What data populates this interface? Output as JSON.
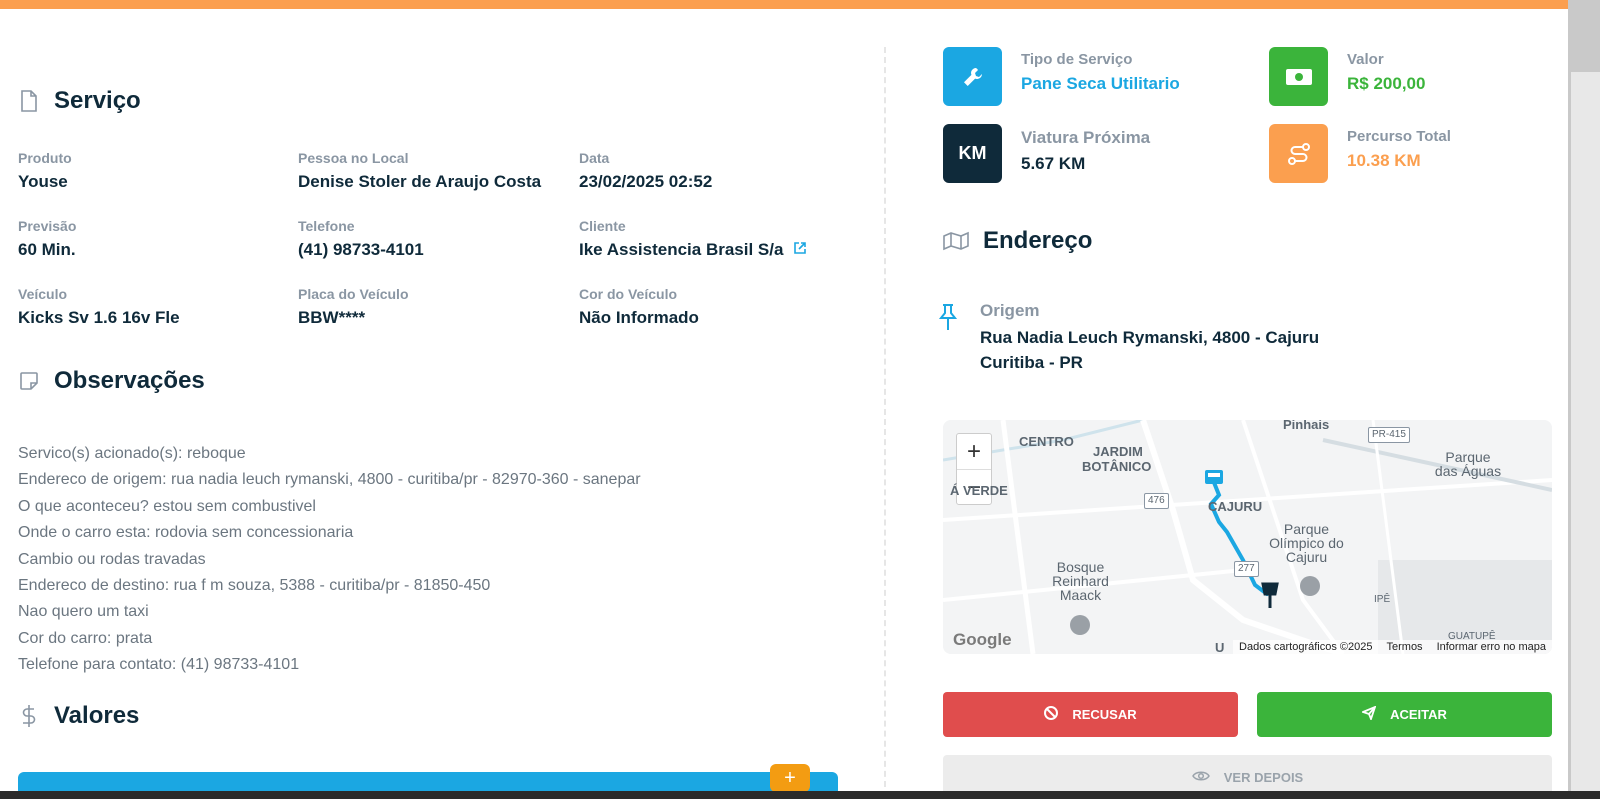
{
  "servico": {
    "title": "Serviço",
    "fields": [
      {
        "label": "Produto",
        "value": "Youse"
      },
      {
        "label": "Pessoa no Local",
        "value": "Denise Stoler de Araujo Costa"
      },
      {
        "label": "Data",
        "value": "23/02/2025 02:52"
      },
      {
        "label": "Previsão",
        "value": "60 Min."
      },
      {
        "label": "Telefone",
        "value": "(41) 98733-4101"
      },
      {
        "label": "Cliente",
        "value": "Ike Assistencia Brasil S/a"
      },
      {
        "label": "Veículo",
        "value": "Kicks Sv 1.6 16v Fle"
      },
      {
        "label": "Placa do Veículo",
        "value": "BBW****"
      },
      {
        "label": "Cor do Veículo",
        "value": "Não Informado"
      }
    ]
  },
  "observacoes": {
    "title": "Observações",
    "lines": [
      "Servico(s) acionado(s): reboque",
      "Endereco de origem: rua nadia leuch rymanski, 4800 - curitiba/pr - 82970-360 - sanepar",
      "O que aconteceu? estou sem combustivel",
      "Onde o carro esta: rodovia sem concessionaria",
      "Cambio ou rodas travadas",
      "Endereco de destino: rua f m souza, 5388 - curitiba/pr - 81850-450",
      "Nao quero um taxi",
      "Cor do carro: prata",
      "Telefone para contato: (41) 98733-4101"
    ]
  },
  "valores": {
    "title": "Valores",
    "add_label": "+"
  },
  "stats": [
    {
      "label": "Tipo de Serviço",
      "value": "Pane Seca Utilitario",
      "icon": "wrench-icon",
      "color": "#1ba7e2"
    },
    {
      "label": "Valor",
      "value": "R$ 200,00",
      "icon": "money-icon",
      "color": "#3bb43b"
    },
    {
      "label": "Viatura Próxima",
      "value": "5.67 KM",
      "icon": "KM",
      "color": "#0f2a3a"
    },
    {
      "label": "Percurso Total",
      "value": "10.38 KM",
      "icon": "route-icon",
      "color": "#fb9f4f"
    }
  ],
  "endereco": {
    "title": "Endereço",
    "origem_label": "Origem",
    "line1": "Rua Nadia Leuch Rymanski, 4800 - Cajuru",
    "line2": "Curitiba - PR"
  },
  "map": {
    "zoom_in": "+",
    "zoom_out": "−",
    "labels": {
      "pinhais": "Pinhais",
      "pr415": "PR-415",
      "centro": "CENTRO",
      "jardim": "JARDIM",
      "botanico": "BOTÂNICO",
      "verde": "Á  VERDE",
      "cajuru": "CAJURU",
      "parque_aguas": "Parque das Águas",
      "rd476": "476",
      "parque_olimpico": "Parque Olímpico do Cajuru",
      "rd277": "277",
      "bosque": "Bosque Reinhard Maack",
      "ipe": "IPÊ",
      "guatupe": "GUATUPÊ",
      "u": "U"
    },
    "logo": "Google",
    "footer": [
      "Dados cartográficos ©2025",
      "Termos",
      "Informar erro no mapa"
    ]
  },
  "buttons": {
    "recusar": "RECUSAR",
    "aceitar": "ACEITAR",
    "ver_depois": "VER DEPOIS"
  },
  "colors": {
    "accent_orange": "#fb9f4f",
    "blue": "#1ba7e2",
    "green": "#3bb43b",
    "red": "#e04d4d",
    "navy": "#0f2a3a"
  }
}
